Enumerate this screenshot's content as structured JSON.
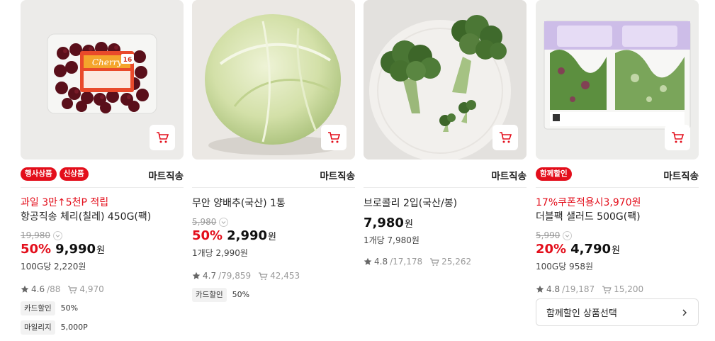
{
  "colors": {
    "accent": "#e30e1b"
  },
  "products": [
    {
      "image": "cherry-pack-photo",
      "badges": [
        "행사상품",
        "신상품"
      ],
      "shipping": "마트직송",
      "promo": "과일 3만↑5천P 적립",
      "name": "항공직송 체리(칠레) 450G(팩)",
      "original_price": "19,980",
      "discount_rate": "50%",
      "price": "9,990",
      "currency": "원",
      "unit_price": "100G당 2,220원",
      "rating": "4.6",
      "review_count": "/88",
      "cart_count": "4,970",
      "benefits": [
        {
          "tag": "카드할인",
          "value": "50%"
        },
        {
          "tag": "마일리지",
          "value": "5,000P"
        }
      ]
    },
    {
      "image": "cabbage-photo",
      "badges": [],
      "shipping": "마트직송",
      "promo": "",
      "name": "무안 양배추(국산) 1통",
      "original_price": "5,980",
      "discount_rate": "50%",
      "price": "2,990",
      "currency": "원",
      "unit_price": "1개당 2,990원",
      "rating": "4.7",
      "review_count": "/79,859",
      "cart_count": "42,453",
      "benefits": [
        {
          "tag": "카드할인",
          "value": "50%"
        }
      ]
    },
    {
      "image": "broccoli-photo",
      "badges": [],
      "shipping": "마트직송",
      "promo": "",
      "name": "브로콜리 2입(국산/봉)",
      "original_price": "",
      "discount_rate": "",
      "price": "7,980",
      "currency": "원",
      "unit_price": "1개당 7,980원",
      "rating": "4.8",
      "review_count": "/17,178",
      "cart_count": "25,262",
      "benefits": []
    },
    {
      "image": "salad-pack-photo",
      "badges": [
        "함께할인"
      ],
      "shipping": "마트직송",
      "promo": "17%쿠폰적용시3,970원",
      "name": "더블팩 샐러드 500G(팩)",
      "original_price": "5,990",
      "discount_rate": "20%",
      "price": "4,790",
      "currency": "원",
      "unit_price": "100G당 958원",
      "rating": "4.8",
      "review_count": "/19,187",
      "cart_count": "15,200",
      "benefits": [],
      "bundle_button": "함께할인 상품선택"
    }
  ],
  "icons": {
    "cart": "cart-icon",
    "star": "star-icon",
    "cart_count": "cart-count-icon",
    "chevron": "chevron-right-icon"
  }
}
